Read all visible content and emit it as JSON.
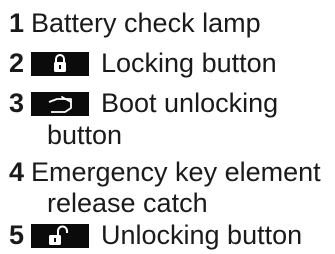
{
  "items": [
    {
      "number": "1",
      "label": "Battery check lamp"
    },
    {
      "number": "2",
      "label": "Locking button",
      "icon": "lock-closed-icon"
    },
    {
      "number": "3",
      "label": "Boot unlocking",
      "label_cont": "button",
      "icon": "boot-open-icon"
    },
    {
      "number": "4",
      "label": "Emergency key element",
      "label_cont": "release catch"
    },
    {
      "number": "5",
      "label": "Unlocking button",
      "icon": "lock-open-icon"
    }
  ],
  "colors": {
    "text": "#1a1a1a",
    "icon_background": "#0b0b0b",
    "icon_foreground": "#ffffff"
  }
}
